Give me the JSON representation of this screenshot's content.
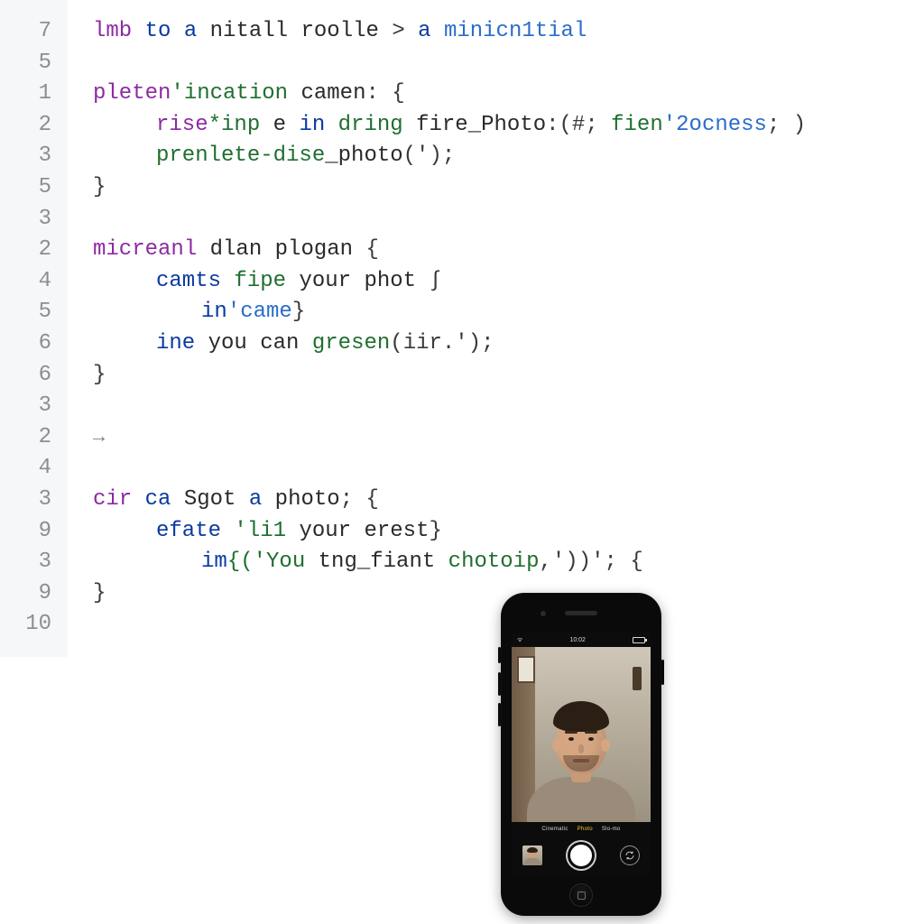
{
  "gutter": [
    "7",
    "5",
    "1",
    "2",
    "3",
    "5",
    "3",
    "2",
    "4",
    "5",
    "6",
    "6",
    "3",
    "2",
    "4",
    "3",
    "9",
    "3",
    "9",
    "10"
  ],
  "code": {
    "l0": {
      "a": "lmb",
      "b": "to",
      "c": "a",
      "d": "nitall",
      "e": "roolle",
      "f": ">",
      "g": "a",
      "h": "minicn1tial"
    },
    "l2": {
      "a": "pleten",
      "b": "'incation",
      "c": "camen",
      "d": ": {"
    },
    "l3": {
      "a": "rise",
      "b": "*inp",
      "c": "e",
      "d": "in",
      "e": "dring",
      "f": "fire_Photo",
      "g": ":(#;",
      "h": "fien",
      "i": "'2ocness",
      "j": "; )"
    },
    "l4": {
      "a": "prenlete-dise",
      "b": "_photo",
      "c": "(');"
    },
    "l5": {
      "a": "}"
    },
    "l7": {
      "a": "micreanl",
      "b": "dlan",
      "c": "plogan",
      "d": "{"
    },
    "l8": {
      "a": "camts",
      "b": "fipe",
      "c": "your",
      "d": "phot",
      "e": "∫"
    },
    "l9": {
      "a": "in",
      "b": "'came",
      "c": "}"
    },
    "l10": {
      "a": "ine",
      "b": "you",
      "c": "can",
      "d": "gresen",
      "e": "(iir.');"
    },
    "l11": {
      "a": "}"
    },
    "l13": {
      "a": "→"
    },
    "l15": {
      "a": "cir",
      "b": "ca",
      "c": "Sgot",
      "d": "a",
      "e": "photo",
      "f": "; {"
    },
    "l16": {
      "a": "efate",
      "b": "'li1",
      "c": "your",
      "d": "erest",
      "e": "}"
    },
    "l17": {
      "a": "im",
      "b": "{('You",
      "c": "tng_fiant",
      "d": "chotoip",
      "e": ",'))'; {"
    },
    "l18": {
      "a": "}"
    }
  },
  "phone": {
    "status": {
      "left": "ᯤ",
      "center": "10:02",
      "right_battery": true
    },
    "modes": [
      "Cinematic",
      "Photo",
      "Slo-mo"
    ],
    "active_mode_index": 1
  }
}
